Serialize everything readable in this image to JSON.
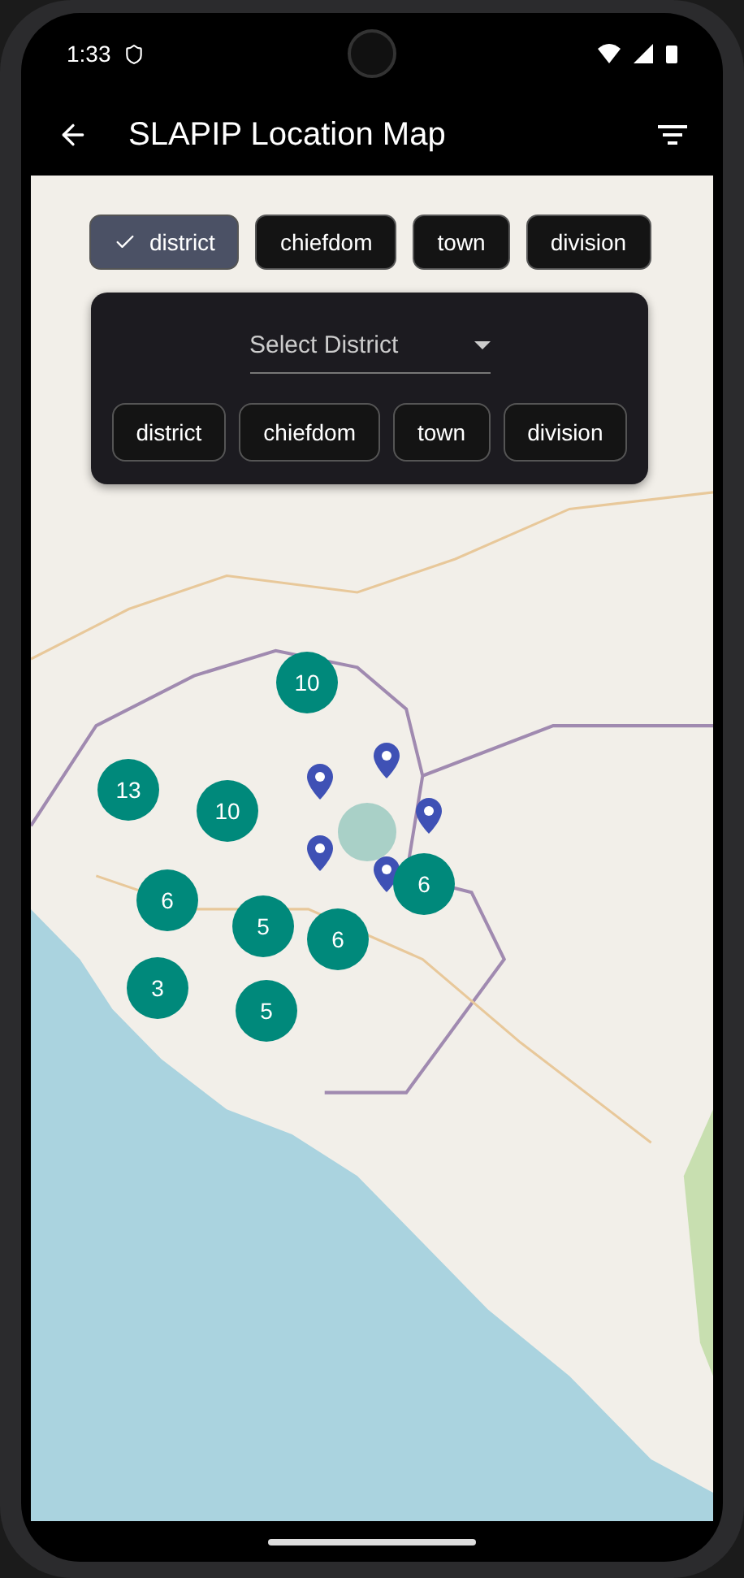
{
  "status_bar": {
    "time": "1:33"
  },
  "app_bar": {
    "title": "SLAPIP Location Map"
  },
  "filter_chips": [
    {
      "label": "district",
      "selected": true
    },
    {
      "label": "chiefdom",
      "selected": false
    },
    {
      "label": "town",
      "selected": false
    },
    {
      "label": "division",
      "selected": false
    }
  ],
  "filter_panel": {
    "dropdown": {
      "placeholder": "Select District"
    },
    "buttons": [
      "district",
      "chiefdom",
      "town",
      "division"
    ]
  },
  "map": {
    "clusters": [
      {
        "count": "10"
      },
      {
        "count": "13"
      },
      {
        "count": "10"
      },
      {
        "count": "6"
      },
      {
        "count": "5"
      },
      {
        "count": "6"
      },
      {
        "count": "6"
      },
      {
        "count": "3"
      },
      {
        "count": "5"
      }
    ]
  }
}
